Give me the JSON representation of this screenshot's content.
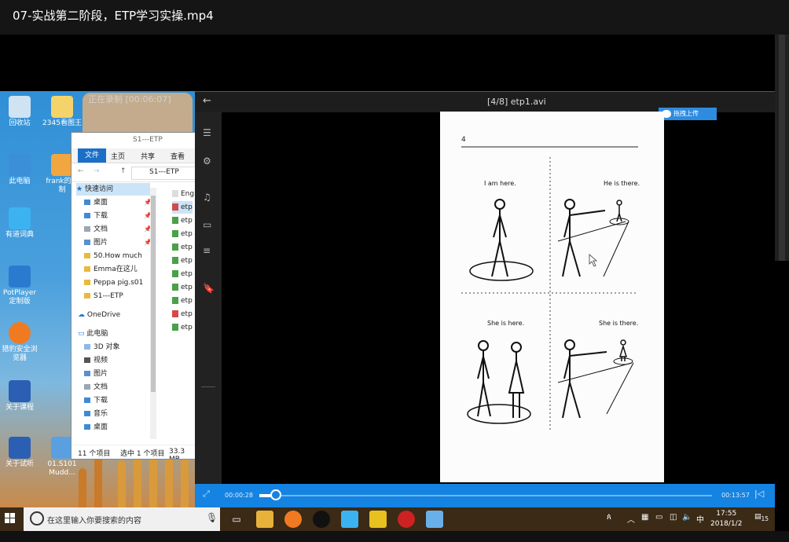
{
  "player": {
    "title": "07-实战第二阶段，ETP学习实操.mp4"
  },
  "recording": {
    "banner": "正在录制 [00:06:07]"
  },
  "desktop": {
    "icons": [
      {
        "label": "回收站"
      },
      {
        "label": "2345看图王"
      },
      {
        "label": "此电脑"
      },
      {
        "label": "frank的录制"
      },
      {
        "label": "有道词典"
      },
      {
        "label": "PotPlayer 定制版"
      },
      {
        "label": "猎豹安全浏览器"
      },
      {
        "label": "关于课程"
      },
      {
        "label": "关于试听"
      },
      {
        "label": "01.S101 Mudd..."
      }
    ]
  },
  "explorer": {
    "title": "S1---ETP",
    "ribbon_tabs": [
      "文件",
      "主页",
      "共享",
      "查看"
    ],
    "address": "S1---ETP",
    "nav": {
      "quick_access": "快速访问",
      "items": [
        "桌面",
        "下载",
        "文档",
        "图片",
        "50.How much",
        "Emma在这儿",
        "Peppa pig.s01",
        "S1---ETP"
      ],
      "onedrive": "OneDrive",
      "this_pc": "此电脑",
      "pc_items": [
        "3D 对象",
        "视频",
        "图片",
        "文档",
        "下载",
        "音乐",
        "桌面"
      ]
    },
    "files": [
      "Eng",
      "etp",
      "etp",
      "etp",
      "etp",
      "etp",
      "etp",
      "etp",
      "etp",
      "etp",
      "etp"
    ],
    "status": {
      "count": "11 个项目",
      "selected": "选中 1 个项目",
      "size": "33.3 MB"
    }
  },
  "inner_player": {
    "title": "[4/8] etp1.avi",
    "time_current": "00:00:28",
    "time_total": "00:13:57",
    "progress": 0.034,
    "upload_label": "拖拽上传"
  },
  "document": {
    "page_number": "4",
    "captions": [
      "I am here.",
      "He is there.",
      "She is here.",
      "She is there."
    ]
  },
  "taskbar": {
    "search_placeholder": "在这里输入你要搜索的内容",
    "ime": "中",
    "time": "17:55",
    "date": "2018/1/2",
    "notification_count": "15"
  }
}
